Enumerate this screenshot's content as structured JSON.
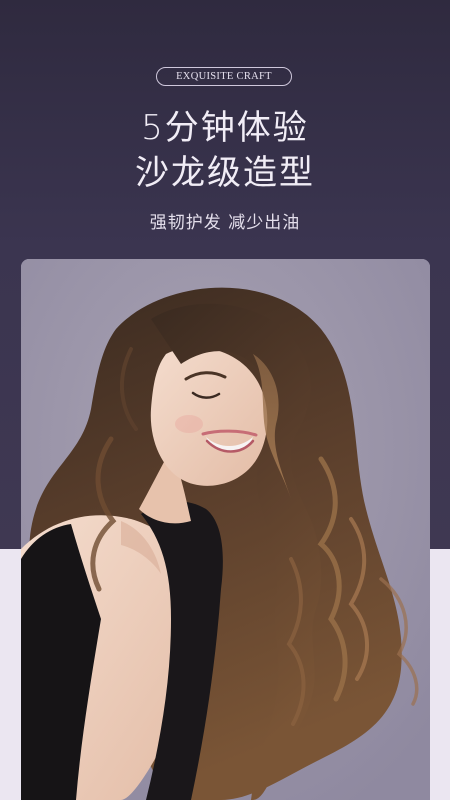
{
  "badge": {
    "text": "EXQUISITE CRAFT"
  },
  "headline": {
    "line1": "5分钟体验",
    "line2": "沙龙级造型"
  },
  "subheadline": "强韧护发  减少出油",
  "colors": {
    "top_background": "#3b3550",
    "bottom_background": "#ebe6f1",
    "photo_background": "#9a93a7",
    "text_light": "#f1edf6"
  },
  "photo": {
    "subject": "model-with-long-curly-hair"
  }
}
